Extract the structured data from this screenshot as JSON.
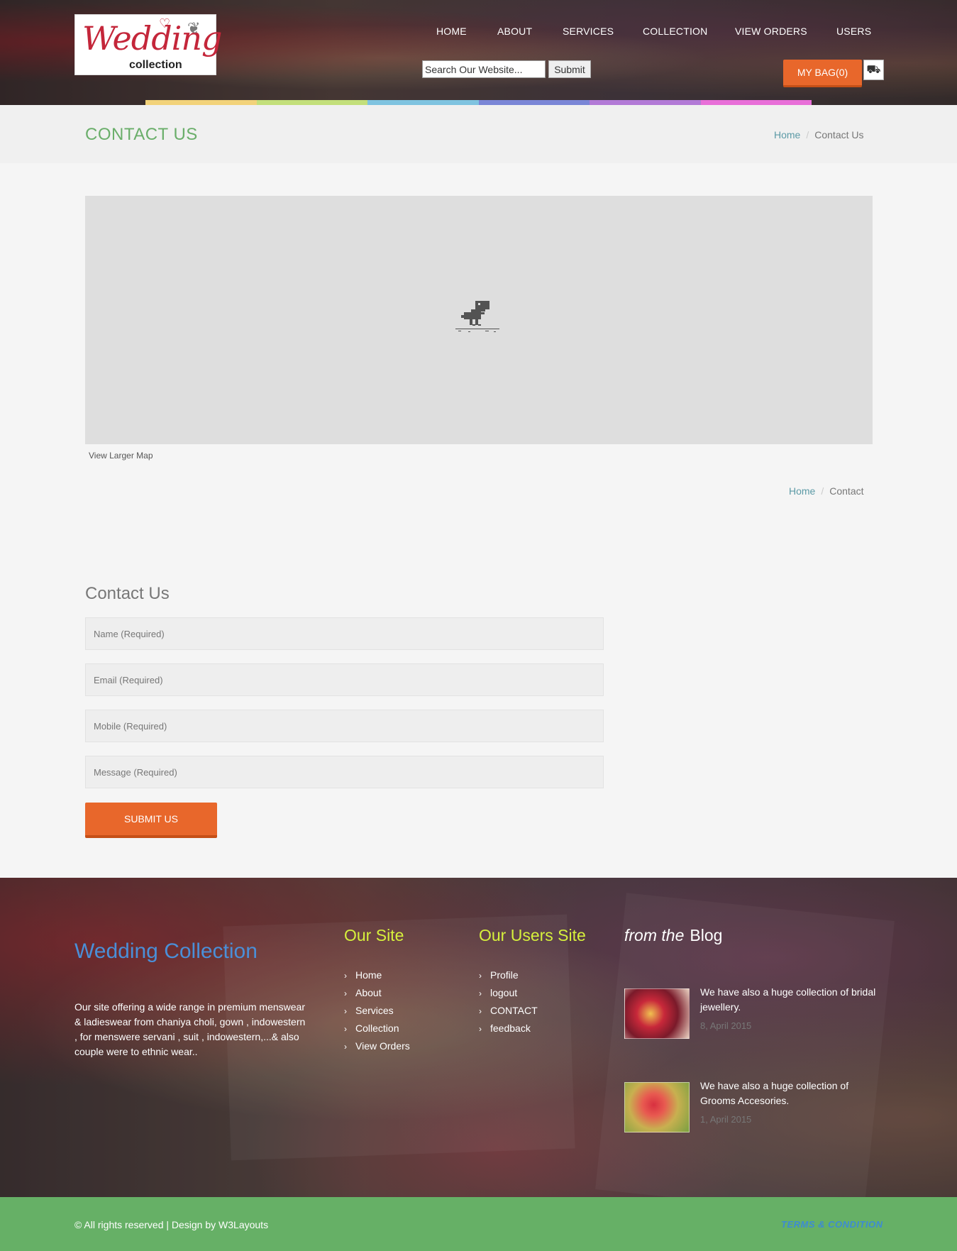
{
  "header": {
    "logo": {
      "word": "Wedding",
      "sub": "collection"
    },
    "nav": [
      "HOME",
      "ABOUT",
      "SERVICES",
      "COLLECTION",
      "VIEW ORDERS",
      "USERS"
    ],
    "search": {
      "placeholder": "Search Our Website...",
      "submit_label": "Submit"
    },
    "bag_label": "MY BAG(0)",
    "color_bar": [
      "#f2d27a",
      "#c3df7b",
      "#7fc3e0",
      "#7a86d6",
      "#b27ad6",
      "#e86fd8"
    ]
  },
  "title_band": {
    "title": "CONTACT US",
    "breadcrumb": {
      "home": "Home",
      "current": "Contact Us"
    }
  },
  "map": {
    "larger_map_label": "View Larger Map",
    "breadcrumb": {
      "home": "Home",
      "current": "Contact"
    }
  },
  "contact_form": {
    "heading": "Contact Us",
    "fields": {
      "name": "Name (Required)",
      "email": "Email (Required)",
      "mobile": "Mobile (Required)",
      "message": "Message (Required)"
    },
    "submit_label": "SUBMIT US"
  },
  "footer": {
    "brand_title": "Wedding Collection",
    "brand_text": "Our site offering a wide range in premium menswear & ladieswear from chaniya choli, gown , indowestern , for menswere servani , suit , indowestern,...& also couple were to ethnic wear..",
    "our_site": {
      "title": "Our Site",
      "links": [
        "Home",
        "About",
        "Services",
        "Collection",
        "View Orders"
      ]
    },
    "users_site": {
      "title": "Our Users Site",
      "links": [
        "Profile",
        "logout",
        "CONTACT",
        "feedback"
      ]
    },
    "blog": {
      "title_em": "from the",
      "title": "Blog",
      "posts": [
        {
          "text": "We have also a huge collection of bridal jewellery.",
          "date": "8, April 2015"
        },
        {
          "text": "We have also a huge collection of Grooms Accesories.",
          "date": "1, April 2015"
        }
      ]
    }
  },
  "bottom_bar": {
    "copyright": "© All rights reserved | Design by W3Layouts",
    "terms": "TERMS & CONDITION"
  },
  "colors": {
    "accent_orange": "#e8672b",
    "title_green": "#6aae6a",
    "footer_green": "#66b066",
    "footer_heading_yellow": "#d6f03c",
    "brand_blue": "#4a8fd8"
  }
}
